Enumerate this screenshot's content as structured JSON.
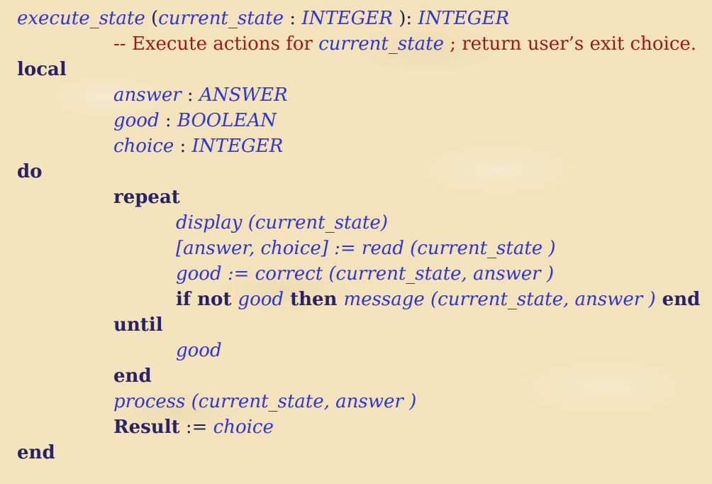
{
  "code": {
    "l1": {
      "feature": "execute_state",
      "open": " (",
      "arg": "current_state",
      "colon": " : ",
      "argtype": "INTEGER",
      "close": " ): ",
      "rettype": "INTEGER"
    },
    "l2": {
      "prefix": "-- Execute actions for ",
      "arg": "current_state",
      "suffix": " ; return user’s exit choice."
    },
    "l3": {
      "kw": "local"
    },
    "l4": {
      "name": "answer",
      "colon": " : ",
      "type": "ANSWER"
    },
    "l5": {
      "name": "good",
      "colon": " : ",
      "type": "BOOLEAN"
    },
    "l6": {
      "name": "choice",
      "colon": " : ",
      "type": "INTEGER"
    },
    "l7": {
      "kw": "do"
    },
    "l8": {
      "kw": "repeat"
    },
    "l9": {
      "text": "display (current_state)"
    },
    "l10": {
      "text": "[answer, choice] := read (current_state )"
    },
    "l11": {
      "text": "good := correct (current_state, answer )"
    },
    "l12": {
      "kw_if": "if not ",
      "cond": "good",
      "kw_then": " then ",
      "call": "message (current_state, answer )",
      "kw_end": " end"
    },
    "l13": {
      "kw": "until"
    },
    "l14": {
      "text": "good"
    },
    "l15": {
      "kw": "end"
    },
    "l16": {
      "text": "process (current_state, answer )"
    },
    "l17": {
      "kw": "Result",
      "op": " := ",
      "val": "choice"
    },
    "l18": {
      "kw": "end"
    }
  }
}
